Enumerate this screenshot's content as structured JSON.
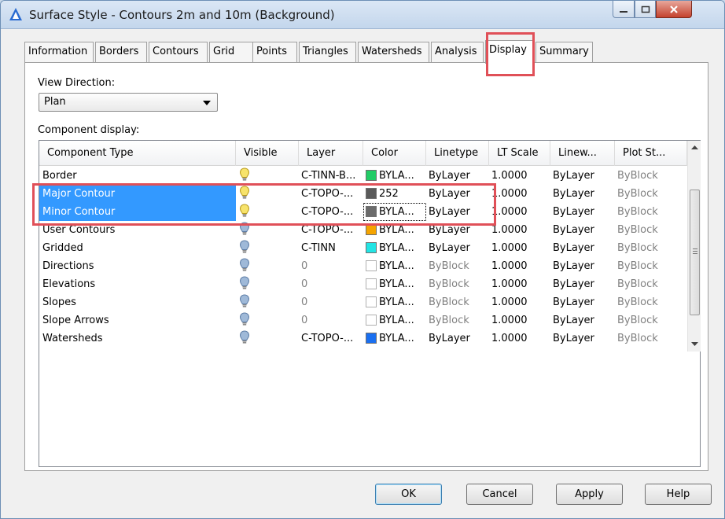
{
  "window": {
    "title": "Surface Style - Contours 2m and 10m (Background)",
    "icons": {
      "app": "autocad-a-icon",
      "minimize": "minimize-icon",
      "maximize": "maximize-icon",
      "close": "close-icon"
    }
  },
  "tabs": [
    {
      "label": "Information"
    },
    {
      "label": "Borders"
    },
    {
      "label": "Contours"
    },
    {
      "label": "Grid"
    },
    {
      "label": "Points"
    },
    {
      "label": "Triangles"
    },
    {
      "label": "Watersheds"
    },
    {
      "label": "Analysis"
    },
    {
      "label": "Display",
      "active": true
    },
    {
      "label": "Summary"
    }
  ],
  "view_direction": {
    "label": "View Direction:",
    "value": "Plan"
  },
  "component_display": {
    "label": "Component display:",
    "columns": [
      "Component Type",
      "Visible",
      "Layer",
      "Color",
      "Linetype",
      "LT Scale",
      "Linew...",
      "Plot St..."
    ],
    "rows": [
      {
        "type": "Border",
        "visible": true,
        "layer": "C-TINN-B...",
        "color_swatch": "#22cc66",
        "color": "BYLA...",
        "linetype": "ByLayer",
        "lt_scale": "1.0000",
        "lineweight": "ByLayer",
        "plot_style": "ByBlock"
      },
      {
        "type": "Major Contour",
        "visible": true,
        "selected": true,
        "layer": "C-TOPO-...",
        "color_swatch": "#5a5a5a",
        "color": "252",
        "linetype": "ByLayer",
        "lt_scale": "1.0000",
        "lineweight": "ByLayer",
        "plot_style": "ByBlock"
      },
      {
        "type": "Minor Contour",
        "visible": true,
        "selected": true,
        "layer": "C-TOPO-...",
        "color_swatch": "#6b6b6b",
        "color": "BYLA...",
        "linetype": "ByLayer",
        "lt_scale": "1.0000",
        "lineweight": "ByLayer",
        "plot_style": "ByBlock"
      },
      {
        "type": "User Contours",
        "visible": false,
        "layer": "C-TOPO-...",
        "color_swatch": "#f5a400",
        "color": "BYLA...",
        "linetype": "ByLayer",
        "lt_scale": "1.0000",
        "lineweight": "ByLayer",
        "plot_style": "ByBlock"
      },
      {
        "type": "Gridded",
        "visible": false,
        "layer": "C-TINN",
        "color_swatch": "#22e4e4",
        "color": "BYLA...",
        "linetype": "ByLayer",
        "lt_scale": "1.0000",
        "lineweight": "ByLayer",
        "plot_style": "ByBlock"
      },
      {
        "type": "Directions",
        "visible": false,
        "layer": "0",
        "color_swatch": "",
        "color": "BYLA...",
        "linetype": "ByBlock",
        "lt_scale": "1.0000",
        "lineweight": "ByLayer",
        "plot_style": "ByBlock"
      },
      {
        "type": "Elevations",
        "visible": false,
        "layer": "0",
        "color_swatch": "",
        "color": "BYLA...",
        "linetype": "ByBlock",
        "lt_scale": "1.0000",
        "lineweight": "ByLayer",
        "plot_style": "ByBlock"
      },
      {
        "type": "Slopes",
        "visible": false,
        "layer": "0",
        "color_swatch": "",
        "color": "BYLA...",
        "linetype": "ByBlock",
        "lt_scale": "1.0000",
        "lineweight": "ByLayer",
        "plot_style": "ByBlock"
      },
      {
        "type": "Slope Arrows",
        "visible": false,
        "layer": "0",
        "color_swatch": "",
        "color": "BYLA...",
        "linetype": "ByBlock",
        "lt_scale": "1.0000",
        "lineweight": "ByLayer",
        "plot_style": "ByBlock"
      },
      {
        "type": "Watersheds",
        "visible": false,
        "layer": "C-TOPO-...",
        "color_swatch": "#1a6ff0",
        "color": "BYLA...",
        "linetype": "ByLayer",
        "lt_scale": "1.0000",
        "lineweight": "ByLayer",
        "plot_style": "ByBlock"
      }
    ]
  },
  "buttons": {
    "ok": "OK",
    "cancel": "Cancel",
    "apply": "Apply",
    "help": "Help"
  },
  "colors": {
    "selection": "#3399ff",
    "annotation_box": "#e05058",
    "bulb_on": "#f7e36b",
    "bulb_off": "#9fb9d8"
  }
}
